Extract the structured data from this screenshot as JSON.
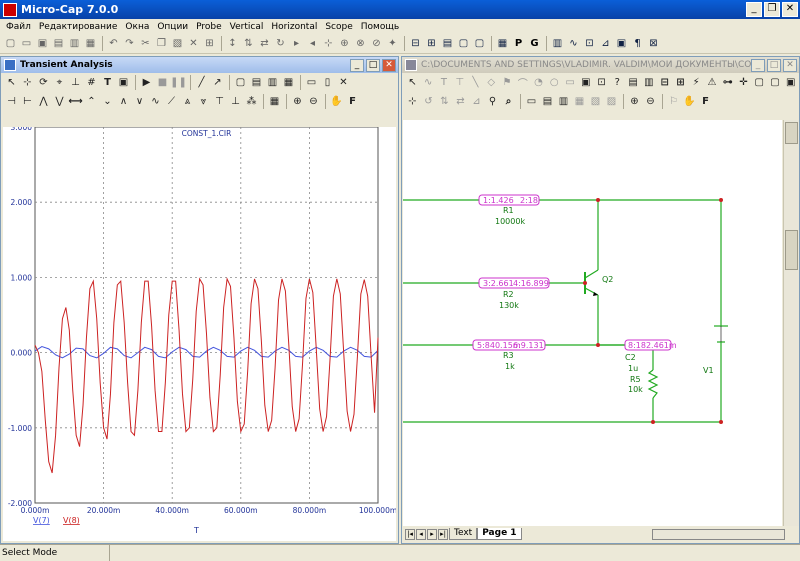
{
  "app": {
    "title": "Micro-Cap 7.0.0"
  },
  "menu": [
    "Файл",
    "Редактирование",
    "Окна",
    "Опции",
    "Probe",
    "Vertical",
    "Horizontal",
    "Scope",
    "Помощь"
  ],
  "main_toolbar": {
    "letters": [
      "P",
      "G"
    ]
  },
  "transient": {
    "title": "Transient Analysis",
    "toolbar_letter": "F",
    "chart_data": {
      "type": "line",
      "title": "CONST_1.CIR",
      "xlabel": "T",
      "xlim": [
        0,
        100
      ],
      "ylim": [
        -2,
        3
      ],
      "x_tick_labels": [
        "0.000m",
        "20.000m",
        "40.000m",
        "60.000m",
        "80.000m",
        "100.000m"
      ],
      "y_tick_labels": [
        "3.000",
        "2.000",
        "1.000",
        "0.000",
        "-1.000",
        "-2.000"
      ],
      "grid": true,
      "series": [
        {
          "name": "V(7)",
          "color": "#4455dd",
          "x": [
            0,
            2,
            4,
            6,
            8,
            10,
            12,
            14,
            16,
            18,
            20,
            22,
            24,
            26,
            28,
            30,
            32,
            34,
            36,
            38,
            40,
            42,
            44,
            46,
            48,
            50,
            52,
            54,
            56,
            58,
            60,
            62,
            64,
            66,
            68,
            70,
            72,
            74,
            76,
            78,
            80,
            82,
            84,
            86,
            88,
            90,
            92,
            94,
            96,
            98,
            100
          ],
          "y": [
            0.02,
            0.08,
            0.05,
            -0.03,
            -0.07,
            -0.02,
            0.06,
            0.05,
            -0.04,
            -0.07,
            -0.01,
            0.07,
            0.05,
            -0.04,
            -0.07,
            0.0,
            0.07,
            0.04,
            -0.05,
            -0.07,
            0.01,
            0.07,
            0.04,
            -0.05,
            -0.06,
            0.02,
            0.07,
            0.03,
            -0.05,
            -0.06,
            0.02,
            0.07,
            0.03,
            -0.05,
            -0.06,
            0.02,
            0.07,
            0.03,
            -0.05,
            -0.06,
            0.02,
            0.07,
            0.03,
            -0.05,
            -0.06,
            0.02,
            0.07,
            0.03,
            -0.05,
            -0.06,
            0.03
          ]
        },
        {
          "name": "V(8)",
          "color": "#cc2222",
          "x": [
            0,
            1,
            2,
            3,
            4,
            5,
            6,
            7,
            8,
            9,
            10,
            11,
            12,
            13,
            14,
            15,
            16,
            17,
            18,
            19,
            20,
            21,
            22,
            23,
            24,
            25,
            26,
            27,
            28,
            29,
            30,
            31,
            32,
            33,
            34,
            35,
            36,
            37,
            38,
            39,
            40,
            41,
            42,
            43,
            44,
            45,
            46,
            47,
            48,
            49,
            50,
            51,
            52,
            53,
            54,
            55,
            56,
            57,
            58,
            59,
            60,
            61,
            62,
            63,
            64,
            65,
            66,
            67,
            68,
            69,
            70,
            71,
            72,
            73,
            74,
            75,
            76,
            77,
            78,
            79,
            80,
            81,
            82,
            83,
            84,
            85,
            86,
            87,
            88,
            89,
            90,
            91,
            92,
            93,
            94,
            95,
            96,
            97,
            98,
            99,
            100
          ],
          "y": [
            0.1,
            0.0,
            -0.25,
            -0.9,
            -1.45,
            -1.6,
            -1.1,
            -0.2,
            0.45,
            0.6,
            0.3,
            -0.5,
            -1.1,
            -1.25,
            -0.7,
            0.2,
            0.85,
            0.95,
            0.45,
            -0.4,
            -1.0,
            -1.15,
            -0.55,
            0.4,
            0.9,
            0.95,
            0.4,
            -0.4,
            -1.05,
            -1.1,
            -0.5,
            0.4,
            0.95,
            0.95,
            0.35,
            -0.5,
            -1.05,
            -1.05,
            -0.4,
            0.5,
            0.95,
            0.95,
            0.3,
            -0.55,
            -1.05,
            -1.0,
            -0.35,
            0.55,
            0.98,
            0.9,
            0.25,
            -0.6,
            -1.05,
            -1.0,
            -0.3,
            0.6,
            0.98,
            0.88,
            0.2,
            -0.65,
            -1.05,
            -0.95,
            -0.25,
            0.65,
            0.98,
            0.85,
            0.15,
            -0.7,
            -1.05,
            -0.9,
            -0.2,
            0.7,
            0.98,
            0.82,
            0.1,
            -0.72,
            -1.05,
            -0.88,
            -0.15,
            0.72,
            0.98,
            0.8,
            0.05,
            -0.75,
            -1.05,
            -0.85,
            -0.1,
            0.75,
            0.98,
            0.78,
            0.0,
            -0.78,
            -1.05,
            -0.82,
            -0.05,
            0.78,
            0.97,
            0.75,
            -0.05,
            -0.8,
            0.2
          ]
        }
      ]
    }
  },
  "schematic": {
    "title": "C:\\DOCUMENTS AND SETTINGS\\VLADIMIR. VALDIM\\МОИ ДОКУМЕНТЫ\\CONST...",
    "toolbar_letter": "F",
    "tabs": [
      "Text",
      "Page 1"
    ],
    "components": [
      {
        "ref": "R1",
        "value": "10000k"
      },
      {
        "ref": "R2",
        "value": "130k"
      },
      {
        "ref": "R3",
        "value": "1k"
      },
      {
        "ref": "C2",
        "value": "1u"
      },
      {
        "ref": "R5",
        "value": "10k"
      },
      {
        "ref": "Q2",
        "value": ""
      },
      {
        "ref": "V1",
        "value": ""
      }
    ],
    "probes": [
      {
        "a": "1:1.426",
        "b": "2:18"
      },
      {
        "a": "3:2.661",
        "b": "4:16.899"
      },
      {
        "a": "5:840.15m",
        "b": "6:9.131"
      },
      {
        "a": "8:182.461m",
        "b": ""
      }
    ]
  },
  "status": {
    "mode": "Select Mode"
  },
  "colors": {
    "wire": "#22aa22",
    "node": "#cc2222",
    "probe": "#cc33cc",
    "component_text": "#117711"
  }
}
